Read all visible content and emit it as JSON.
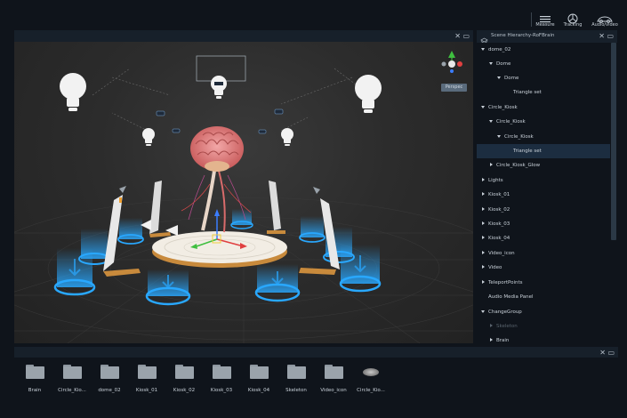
{
  "toolbar": {
    "tools": [
      {
        "label": "Measure",
        "icon": "measure-icon"
      },
      {
        "label": "Tracking",
        "icon": "tracking-icon"
      },
      {
        "label": "Audio/video",
        "icon": "audiovideo-icon"
      }
    ]
  },
  "viewport": {
    "projection_label": "Perspec",
    "gizmo_axes": [
      "y",
      "x",
      "z"
    ]
  },
  "hierarchy": {
    "title": "Scene Hierarchy-RoFBrain",
    "items": [
      {
        "label": "dome_02",
        "expanded": true
      },
      {
        "label": "Dome",
        "expanded": true
      },
      {
        "label": "Dome",
        "expanded": true
      },
      {
        "label": "Triangle set"
      },
      {
        "label": "Circle_Kiosk",
        "expanded": true
      },
      {
        "label": "Circle_Kiosk",
        "expanded": true
      },
      {
        "label": "Circle_Kiosk",
        "expanded": true
      },
      {
        "label": "Triangle set",
        "selected": true
      },
      {
        "label": "Circle_Kiosk_Glow",
        "expanded": false
      },
      {
        "label": "Lights",
        "expanded": false
      },
      {
        "label": "Kiosk_01",
        "expanded": false
      },
      {
        "label": "Kiosk_02",
        "expanded": false
      },
      {
        "label": "Kiosk_03",
        "expanded": false
      },
      {
        "label": "Kiosk_04",
        "expanded": false
      },
      {
        "label": "Video_icon",
        "expanded": false
      },
      {
        "label": "Video",
        "expanded": false
      },
      {
        "label": "TeleportPoints",
        "expanded": false
      },
      {
        "label": "Audio Media Panel"
      },
      {
        "label": "ChangeGroup",
        "expanded": true
      },
      {
        "label": "Skeleton",
        "expanded": false,
        "dim": true
      },
      {
        "label": "Brain",
        "expanded": false
      }
    ]
  },
  "assets": {
    "items": [
      {
        "label": "Brain",
        "type": "folder"
      },
      {
        "label": "Circle_Kio...",
        "type": "folder"
      },
      {
        "label": "dome_02",
        "type": "folder"
      },
      {
        "label": "Kiosk_01",
        "type": "folder"
      },
      {
        "label": "Kiosk_02",
        "type": "folder"
      },
      {
        "label": "Kiosk_03",
        "type": "folder"
      },
      {
        "label": "Kiosk_04",
        "type": "folder"
      },
      {
        "label": "Skeleton",
        "type": "folder"
      },
      {
        "label": "Video_icon",
        "type": "folder"
      },
      {
        "label": "Circle_Kio...",
        "type": "model"
      }
    ]
  },
  "colors": {
    "background": "#0f141b",
    "panel_header": "#17202a",
    "selection": "#1c2d40",
    "glow": "#29a8ff"
  }
}
